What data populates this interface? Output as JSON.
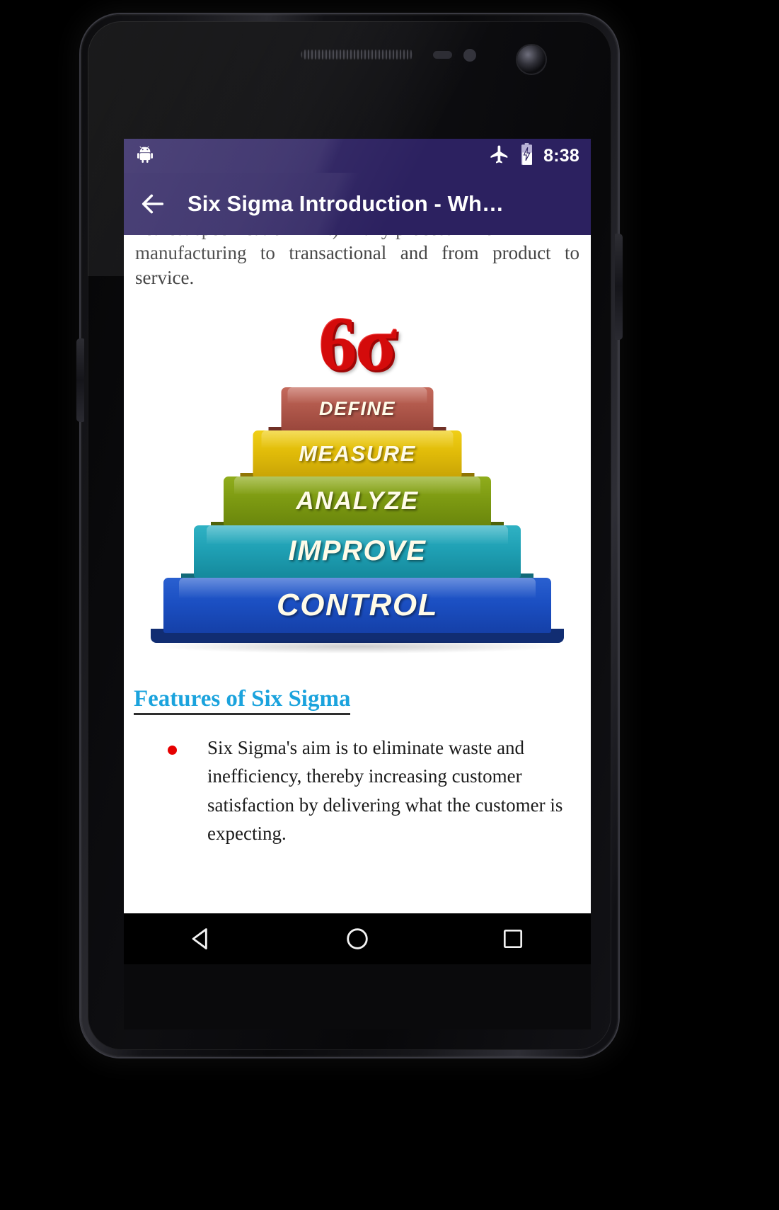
{
  "device": {
    "name": "Android smartphone",
    "icons": {
      "earpiece": "speaker-grille-icon",
      "proximity": "proximity-sensor-icon",
      "light": "light-sensor-icon",
      "camera": "front-camera-icon"
    }
  },
  "statusbar": {
    "notification_icon": "android-robot-icon",
    "airplane_icon": "airplane-mode-icon",
    "battery_icon": "battery-charging-icon",
    "time": "8:38",
    "background": "#2c2160"
  },
  "appbar": {
    "back_icon": "back-arrow-icon",
    "title": "Six Sigma Introduction - Wh…",
    "background": "#2c2160",
    "title_color": "#ffffff"
  },
  "content": {
    "paragraph_clipped": "nearest specification limit) in any process – from",
    "paragraph": "manufacturing to transactional and from product to service.",
    "figure": {
      "name": "six-sigma-dmaic-pyramid",
      "logo": "6σ",
      "logo_color": "#d40b0b",
      "tiers": [
        {
          "label": "DEFINE",
          "color": "#b0584b"
        },
        {
          "label": "MEASURE",
          "color": "#e1bc09"
        },
        {
          "label": "ANALYZE",
          "color": "#7d9a12"
        },
        {
          "label": "IMPROVE",
          "color": "#1fa0b4"
        },
        {
          "label": "CONTROL",
          "color": "#1b4fc2"
        }
      ]
    },
    "heading_link": "Features of Six Sigma",
    "heading_color": "#1ba3dd",
    "bullet_color": "#e60000",
    "bullets": [
      "Six Sigma's aim is to eliminate waste and inefficiency, thereby increasing customer satisfaction by delivering what the customer is expecting."
    ]
  },
  "navbar": {
    "back_icon": "nav-back-triangle-icon",
    "home_icon": "nav-home-circle-icon",
    "recents_icon": "nav-recents-square-icon",
    "background": "#000000"
  }
}
